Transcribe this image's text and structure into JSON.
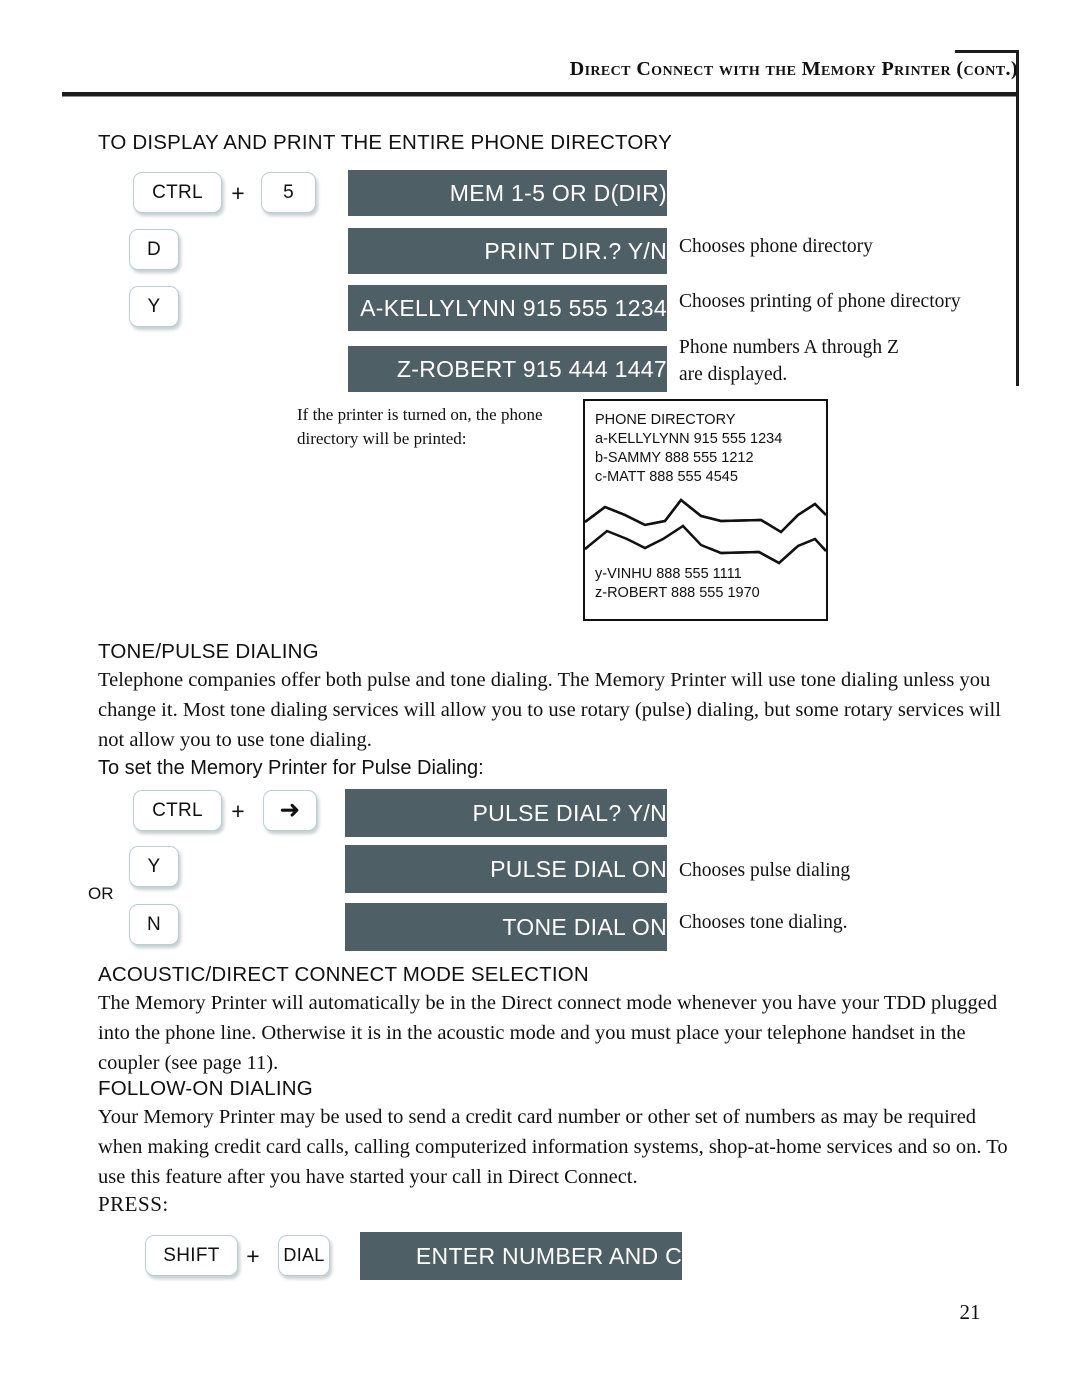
{
  "header": {
    "title": "Direct Connect with the Memory Printer (cont.)"
  },
  "page_number": "21",
  "sections": {
    "directory": {
      "heading": "TO DISPLAY AND PRINT THE ENTIRE PHONE DIRECTORY",
      "steps": [
        {
          "keys": [
            "CTRL",
            "5"
          ],
          "separator": "+",
          "display": "MEM 1-5 OR D(DIR)",
          "caption": ""
        },
        {
          "keys": [
            "D"
          ],
          "display": "PRINT DIR.? Y/N",
          "caption": "Chooses phone directory"
        },
        {
          "keys": [
            "Y"
          ],
          "display": "A-KELLYLYNN 915 555 1234",
          "caption": "Chooses printing of phone directory"
        },
        {
          "keys": [],
          "display": "Z-ROBERT 915 444 1447",
          "caption": "Phone numbers A through Z\nare displayed."
        }
      ],
      "printer_note": "If the printer is turned on, the phone directory will be printed:",
      "printout_top": "PHONE DIRECTORY\na-KELLYLYNN 915 555 1234\nb-SAMMY 888 555 1212\nc-MATT 888 555 4545",
      "printout_bottom": "y-VINHU 888 555 1111\nz-ROBERT 888 555 1970"
    },
    "tone_pulse": {
      "heading": "TONE/PULSE DIALING",
      "paragraph": "Telephone companies offer both pulse and tone dialing. The Memory Printer will use tone dialing unless you change it. Most tone dialing services will allow you to use rotary (pulse) dialing, but some rotary services will not allow you to use tone dialing.",
      "subheading": "To set the Memory Printer for Pulse Dialing:",
      "or_label": "OR",
      "steps": [
        {
          "keys": [
            "CTRL",
            "right-arrow"
          ],
          "separator": "+",
          "display": "PULSE DIAL? Y/N",
          "caption": ""
        },
        {
          "keys": [
            "Y"
          ],
          "display": "PULSE DIAL ON",
          "caption": "Chooses pulse dialing"
        },
        {
          "keys": [
            "N"
          ],
          "display": "TONE DIAL ON",
          "caption": "Chooses tone dialing."
        }
      ]
    },
    "acoustic": {
      "heading": "ACOUSTIC/DIRECT CONNECT MODE SELECTION",
      "paragraph": "The Memory Printer will automatically be in the Direct connect mode whenever you have your TDD plugged into the phone line. Otherwise it is in the acoustic mode and you must place your telephone handset in the coupler (see page 11)."
    },
    "follow_on": {
      "heading": "FOLLOW-ON DIALING",
      "paragraph": "Your Memory Printer may be used to send a credit card number or other set of numbers as may be required when making credit card calls, calling computerized information systems, shop-at-home services and so on. To use this feature after you have started your call in Direct Connect.",
      "press_label": "PRESS:",
      "step": {
        "keys": [
          "SHIFT",
          "DIAL"
        ],
        "separator": "+",
        "display": "ENTER NUMBER AND C"
      }
    }
  },
  "colors": {
    "lcd_background": "#4e6065",
    "lcd_text": "#ffffff",
    "key_border": "#b9cfd2",
    "rule": "#1c1c1c"
  }
}
